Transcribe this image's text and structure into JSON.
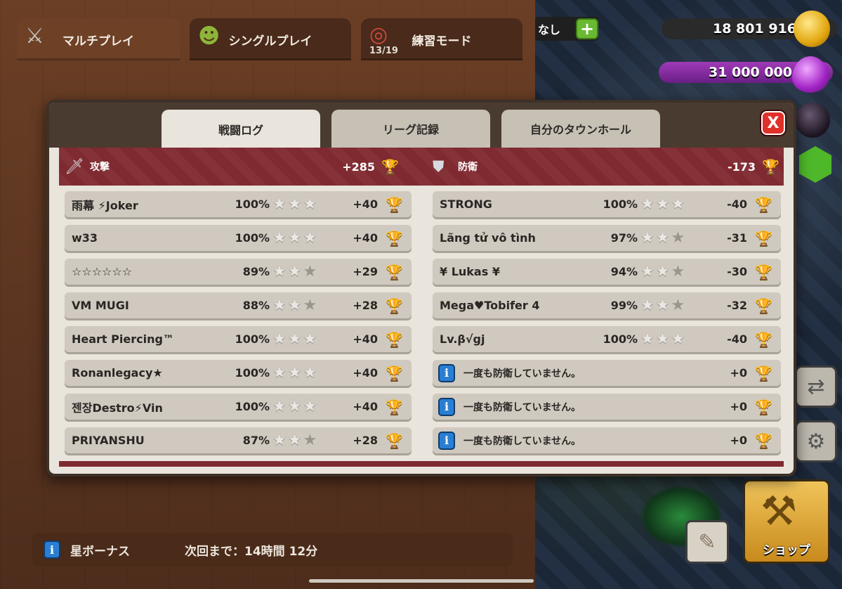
{
  "top_tabs": [
    {
      "label": "マルチプレイ",
      "icon": "crossed-swords-icon",
      "sub": ""
    },
    {
      "label": "シングルプレイ",
      "icon": "goblin-icon",
      "sub": ""
    },
    {
      "label": "練習モード",
      "icon": "target-icon",
      "sub": "13/19"
    }
  ],
  "resources": {
    "shield_status": "なし",
    "gold": "18 801 916",
    "elixir": "31 000 000"
  },
  "modal": {
    "tabs": [
      "戦闘ログ",
      "リーグ記録",
      "自分のタウンホール"
    ],
    "active_tab": 0,
    "close_label": "X",
    "summary": {
      "attack_label": "攻撃",
      "attack_total": "+285",
      "defense_label": "防衛",
      "defense_total": "-173"
    },
    "attacks": [
      {
        "name": "雨幕 ⚡Joker",
        "pct": "100%",
        "stars": 3,
        "trophies": "+40"
      },
      {
        "name": "w33",
        "pct": "100%",
        "stars": 3,
        "trophies": "+40"
      },
      {
        "name": "☆☆☆☆☆☆",
        "pct": "89%",
        "stars": 2,
        "trophies": "+29"
      },
      {
        "name": "VM MUGI",
        "pct": "88%",
        "stars": 2,
        "trophies": "+28"
      },
      {
        "name": "Heart Piercing™",
        "pct": "100%",
        "stars": 3,
        "trophies": "+40"
      },
      {
        "name": "Ronanlegacy★",
        "pct": "100%",
        "stars": 3,
        "trophies": "+40"
      },
      {
        "name": "젠장Destro⚡Vin",
        "pct": "100%",
        "stars": 3,
        "trophies": "+40"
      },
      {
        "name": "PRIYANSHU",
        "pct": "87%",
        "stars": 2,
        "trophies": "+28"
      }
    ],
    "defenses": [
      {
        "name": "STRONG",
        "pct": "100%",
        "stars": 3,
        "trophies": "-40"
      },
      {
        "name": "Lãng tử vô tình",
        "pct": "97%",
        "stars": 2,
        "trophies": "-31"
      },
      {
        "name": "¥ Lukas ¥",
        "pct": "94%",
        "stars": 2,
        "trophies": "-30"
      },
      {
        "name": "Mega♥Tobifer 4",
        "pct": "99%",
        "stars": 2,
        "trophies": "-32"
      },
      {
        "name": "Lv.β√gj",
        "pct": "100%",
        "stars": 3,
        "trophies": "-40"
      }
    ],
    "no_defense_rows": [
      {
        "message": "一度も防衛していません。",
        "trophies": "+0"
      },
      {
        "message": "一度も防衛していません。",
        "trophies": "+0"
      },
      {
        "message": "一度も防衛していません。",
        "trophies": "+0"
      }
    ]
  },
  "bottom_bar": {
    "label": "星ボーナス",
    "next_text": "次回まで：14時間 12分"
  },
  "shop_label": "ショップ",
  "colors": {
    "summary_bg": "#7f2930",
    "trophy": "#f1b60c",
    "close": "#e0302a",
    "info": "#2a7ed2"
  }
}
